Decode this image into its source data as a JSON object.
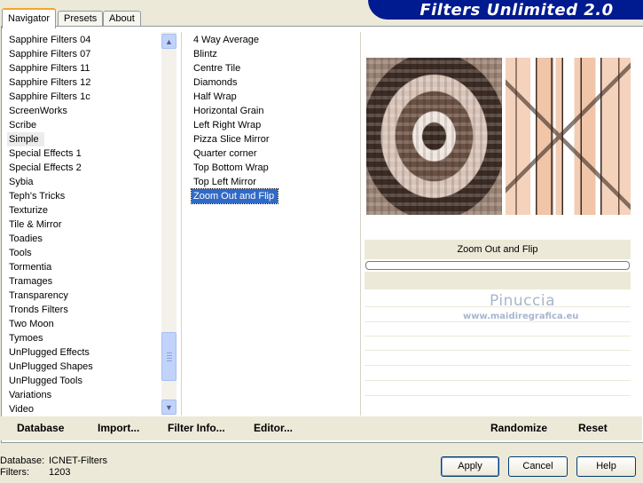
{
  "tabs": [
    {
      "label": "Navigator",
      "active": true
    },
    {
      "label": "Presets",
      "active": false
    },
    {
      "label": "About",
      "active": false
    }
  ],
  "title": "Filters Unlimited 2.0",
  "categories": [
    {
      "label": "Sapphire Filters 04"
    },
    {
      "label": "Sapphire Filters 07"
    },
    {
      "label": "Sapphire Filters 11"
    },
    {
      "label": "Sapphire Filters 12"
    },
    {
      "label": "Sapphire Filters 1c"
    },
    {
      "label": "ScreenWorks"
    },
    {
      "label": "Scribe"
    },
    {
      "label": "Simple",
      "selected": true
    },
    {
      "label": "Special Effects 1"
    },
    {
      "label": "Special Effects 2"
    },
    {
      "label": "Sybia"
    },
    {
      "label": "Teph's Tricks"
    },
    {
      "label": "Texturize"
    },
    {
      "label": "Tile & Mirror"
    },
    {
      "label": "Toadies"
    },
    {
      "label": "Tools"
    },
    {
      "label": "Tormentia"
    },
    {
      "label": "Tramages"
    },
    {
      "label": "Transparency"
    },
    {
      "label": "Tronds Filters"
    },
    {
      "label": "Two Moon"
    },
    {
      "label": "Tymoes"
    },
    {
      "label": "UnPlugged Effects"
    },
    {
      "label": "UnPlugged Shapes"
    },
    {
      "label": "UnPlugged Tools"
    },
    {
      "label": "Variations"
    },
    {
      "label": "Video"
    }
  ],
  "filters": [
    {
      "label": "4 Way Average"
    },
    {
      "label": "Blintz"
    },
    {
      "label": "Centre Tile"
    },
    {
      "label": "Diamonds"
    },
    {
      "label": "Half Wrap"
    },
    {
      "label": "Horizontal Grain"
    },
    {
      "label": "Left Right Wrap"
    },
    {
      "label": "Pizza Slice Mirror"
    },
    {
      "label": "Quarter corner"
    },
    {
      "label": "Top Bottom Wrap"
    },
    {
      "label": "Top Left Mirror"
    },
    {
      "label": "Zoom Out and Flip",
      "selected": true
    }
  ],
  "preview": {
    "filter_name": "Zoom Out and Flip",
    "watermark_name": "Pinuccia",
    "watermark_url": "www.maidiregrafica.eu"
  },
  "toolbar": {
    "database": "Database",
    "import": "Import...",
    "filter_info": "Filter Info...",
    "editor": "Editor...",
    "randomize": "Randomize",
    "reset": "Reset"
  },
  "status": {
    "database_label": "Database:",
    "database_value": "ICNET-Filters",
    "filters_label": "Filters:",
    "filters_value": "1203"
  },
  "buttons": {
    "apply": "Apply",
    "cancel": "Cancel",
    "help": "Help"
  },
  "colors": {
    "banner": "#001a8f",
    "selection": "#316ac5",
    "dialog_bg": "#ece9d8"
  }
}
